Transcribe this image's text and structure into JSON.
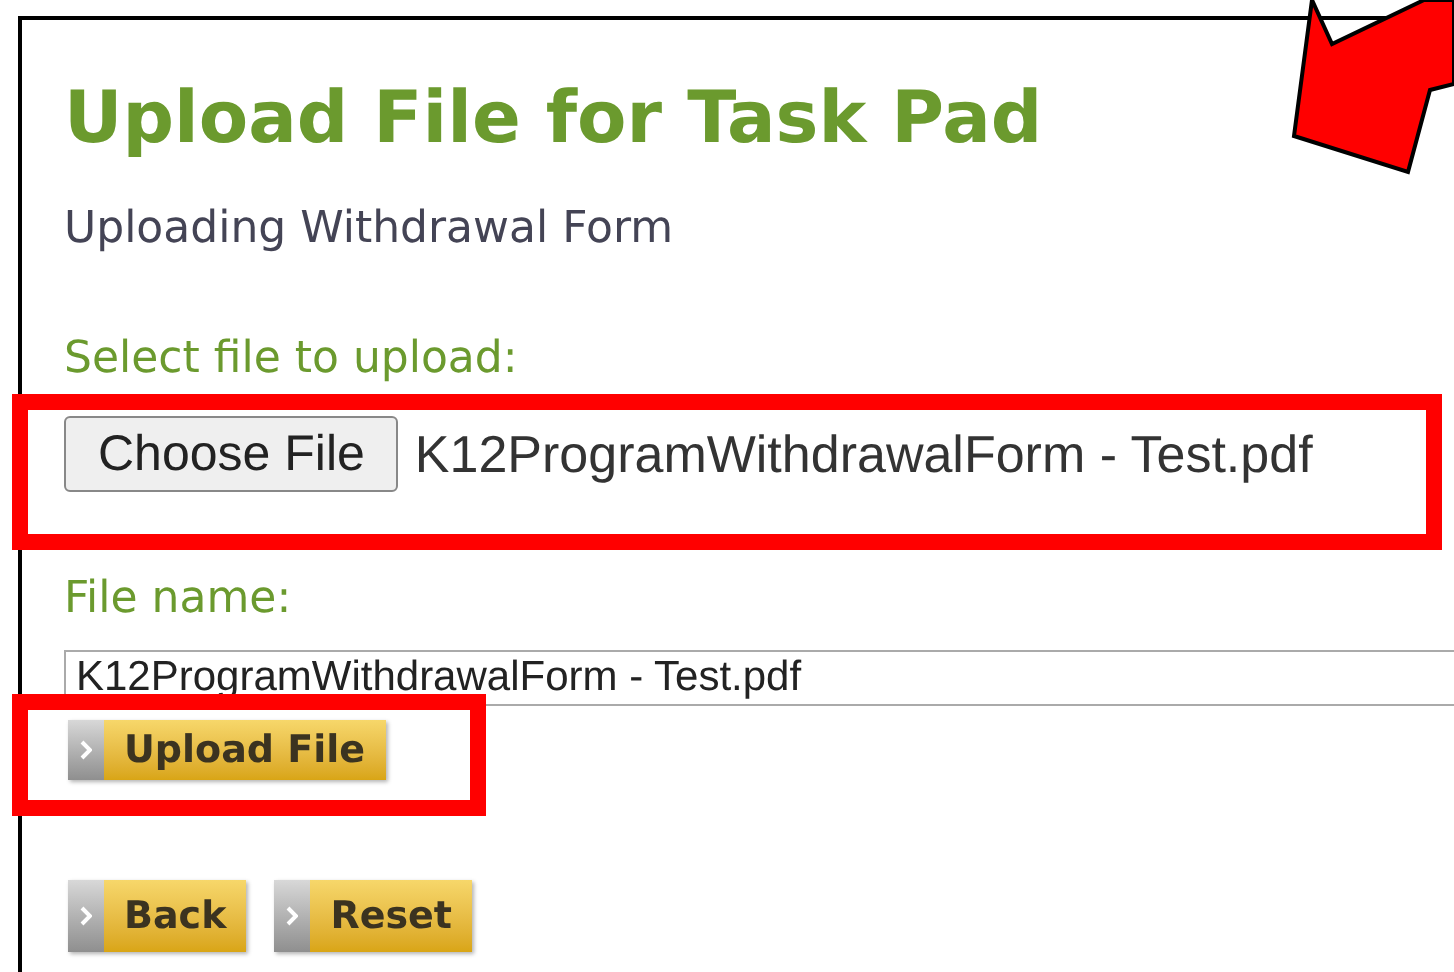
{
  "title": "Upload File for Task Pad",
  "subtitle": "Uploading Withdrawal Form",
  "file_picker": {
    "label": "Select file to upload:",
    "button": "Choose File",
    "chosen_file": "K12ProgramWithdrawalForm - Test.pdf"
  },
  "file_name": {
    "label": "File name:",
    "value": "K12ProgramWithdrawalForm - Test.pdf"
  },
  "upload_button": "Upload File",
  "buttons": [
    "Back",
    "Reset"
  ]
}
